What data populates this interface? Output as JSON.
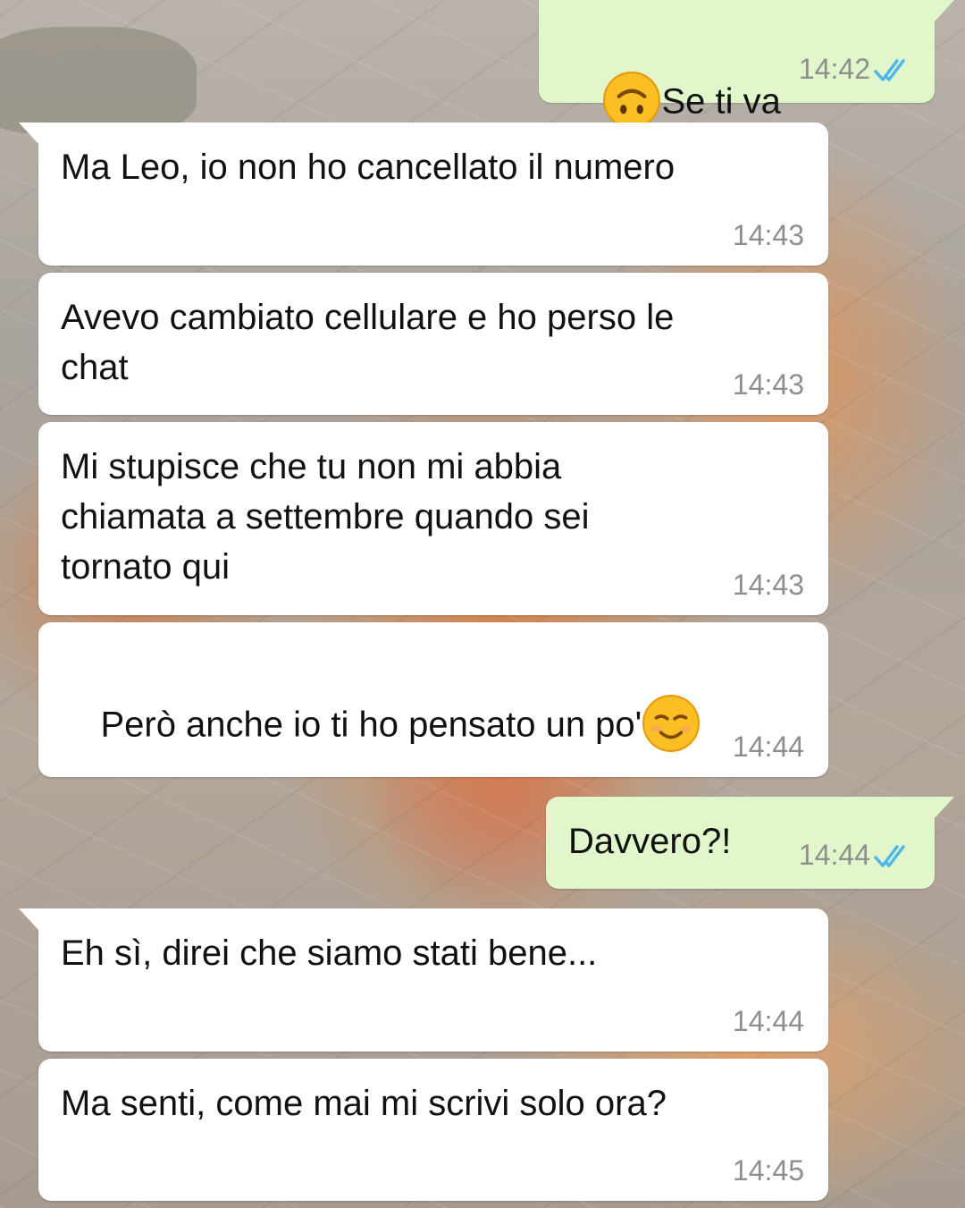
{
  "colors": {
    "incoming_bubble": "#ffffff",
    "outgoing_bubble": "#e1f7cb",
    "timestamp": "#8e8e8e",
    "read_ticks": "#4fb6ec"
  },
  "messages": [
    {
      "direction": "outgoing",
      "emoji": "upside-down-face",
      "text": "Se ti va",
      "time": "14:42",
      "status": "read"
    },
    {
      "direction": "incoming",
      "text": "Ma Leo, io non ho cancellato il numero",
      "time": "14:43"
    },
    {
      "direction": "incoming",
      "text": "Avevo cambiato cellulare e ho perso le\nchat",
      "time": "14:43"
    },
    {
      "direction": "incoming",
      "text": "Mi stupisce che tu non mi abbia\nchiamata a settembre quando sei\ntornato qui",
      "time": "14:43"
    },
    {
      "direction": "incoming",
      "text": "Però anche io ti ho pensato un po'",
      "emoji": "smiling-face",
      "time": "14:44"
    },
    {
      "direction": "outgoing",
      "text": "Davvero?!",
      "time": "14:44",
      "status": "read"
    },
    {
      "direction": "incoming",
      "text": "Eh sì, direi che siamo stati bene...",
      "time": "14:44"
    },
    {
      "direction": "incoming",
      "text": "Ma senti, come mai mi scrivi solo ora?",
      "time": "14:45"
    }
  ]
}
